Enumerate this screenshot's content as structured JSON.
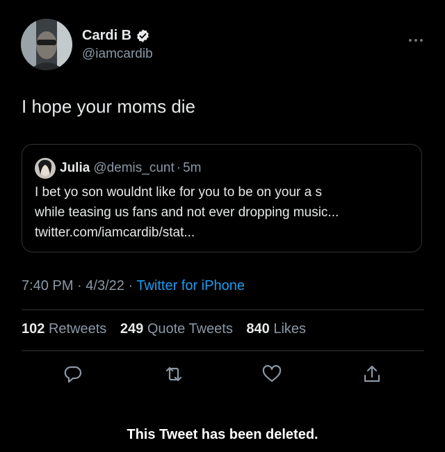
{
  "tweet": {
    "author": {
      "display_name": "Cardi B",
      "handle": "@iamcardib",
      "verified": true,
      "avatar_icon": "profile-photo",
      "verified_icon": "verified-badge-icon"
    },
    "more_icon": "more-options-icon",
    "text": "I hope your moms die",
    "quoted": {
      "author_name": "Julia",
      "handle": "@demis_cunt",
      "separator": "·",
      "time": "5m",
      "lines": [
        "I bet yo son wouldnt like for you to be on your a  s",
        "while teasing us fans and not ever dropping music...",
        "twitter.com/iamcardib/stat..."
      ]
    },
    "meta": {
      "time": "7:40 PM",
      "dot1": "·",
      "date": "4/3/22",
      "dot2": "·",
      "source": "Twitter for iPhone"
    },
    "stats": {
      "retweets_count": "102",
      "retweets_label": "Retweets",
      "quotes_count": "249",
      "quotes_label": "Quote Tweets",
      "likes_count": "840",
      "likes_label": "Likes"
    },
    "actions": {
      "reply_icon": "reply-icon",
      "retweet_icon": "retweet-icon",
      "like_icon": "heart-icon",
      "share_icon": "share-icon"
    }
  },
  "footer": {
    "deleted_notice": "This Tweet has been deleted."
  },
  "colors": {
    "background": "#000000",
    "text_primary": "#e7e9ea",
    "text_secondary": "#8b98a5",
    "link": "#1d9bf0",
    "border": "#2f3336"
  }
}
